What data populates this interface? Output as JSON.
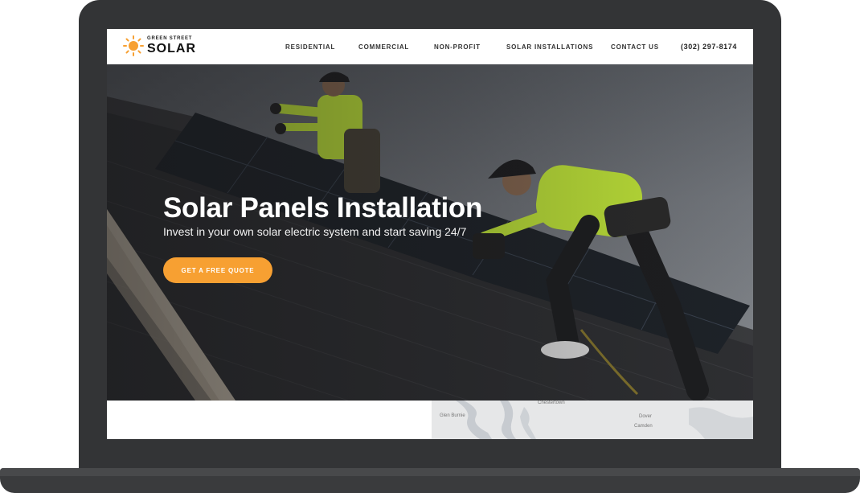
{
  "logo": {
    "small_text": "GREEN STREET",
    "big_text": "SOLAR",
    "icon": "sun-icon"
  },
  "nav": {
    "items": [
      "RESIDENTIAL",
      "COMMERCIAL",
      "NON-PROFIT",
      "SOLAR INSTALLATIONS",
      "CONTACT US"
    ],
    "phone": "(302) 297-8174"
  },
  "hero": {
    "title": "Solar Panels Installation",
    "subtitle": "Invest in your own solar electric system and start saving 24/7",
    "cta_label": "GET A FREE QUOTE"
  },
  "map": {
    "labels": [
      "Chestertown",
      "Glen Burnie",
      "Dover",
      "Camden"
    ]
  },
  "colors": {
    "accent": "#f7a032",
    "device_frame": "#333436",
    "worker_shirt": "#c8ef3a"
  }
}
